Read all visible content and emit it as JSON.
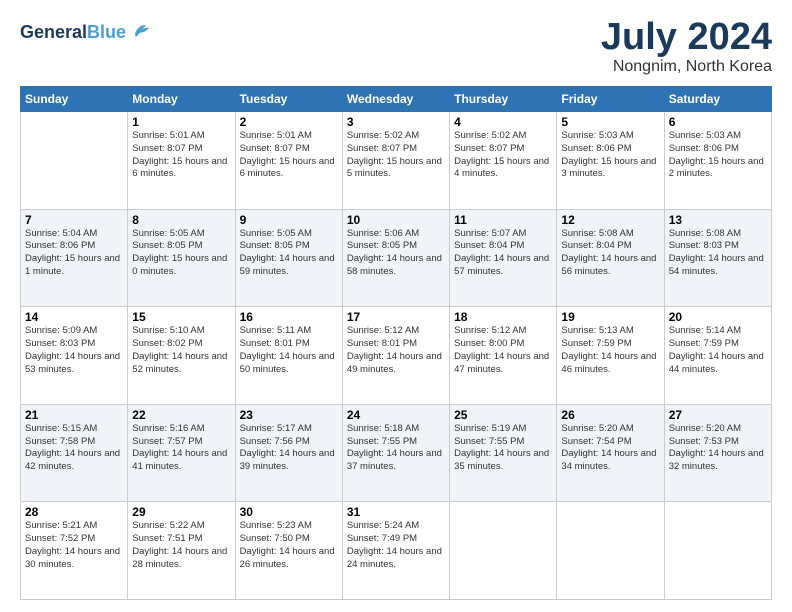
{
  "header": {
    "logo_general": "General",
    "logo_blue": "Blue",
    "month": "July 2024",
    "location": "Nongnim, North Korea"
  },
  "weekdays": [
    "Sunday",
    "Monday",
    "Tuesday",
    "Wednesday",
    "Thursday",
    "Friday",
    "Saturday"
  ],
  "weeks": [
    [
      {
        "day": "",
        "sunrise": "",
        "sunset": "",
        "daylight": ""
      },
      {
        "day": "1",
        "sunrise": "Sunrise: 5:01 AM",
        "sunset": "Sunset: 8:07 PM",
        "daylight": "Daylight: 15 hours and 6 minutes."
      },
      {
        "day": "2",
        "sunrise": "Sunrise: 5:01 AM",
        "sunset": "Sunset: 8:07 PM",
        "daylight": "Daylight: 15 hours and 6 minutes."
      },
      {
        "day": "3",
        "sunrise": "Sunrise: 5:02 AM",
        "sunset": "Sunset: 8:07 PM",
        "daylight": "Daylight: 15 hours and 5 minutes."
      },
      {
        "day": "4",
        "sunrise": "Sunrise: 5:02 AM",
        "sunset": "Sunset: 8:07 PM",
        "daylight": "Daylight: 15 hours and 4 minutes."
      },
      {
        "day": "5",
        "sunrise": "Sunrise: 5:03 AM",
        "sunset": "Sunset: 8:06 PM",
        "daylight": "Daylight: 15 hours and 3 minutes."
      },
      {
        "day": "6",
        "sunrise": "Sunrise: 5:03 AM",
        "sunset": "Sunset: 8:06 PM",
        "daylight": "Daylight: 15 hours and 2 minutes."
      }
    ],
    [
      {
        "day": "7",
        "sunrise": "Sunrise: 5:04 AM",
        "sunset": "Sunset: 8:06 PM",
        "daylight": "Daylight: 15 hours and 1 minute."
      },
      {
        "day": "8",
        "sunrise": "Sunrise: 5:05 AM",
        "sunset": "Sunset: 8:05 PM",
        "daylight": "Daylight: 15 hours and 0 minutes."
      },
      {
        "day": "9",
        "sunrise": "Sunrise: 5:05 AM",
        "sunset": "Sunset: 8:05 PM",
        "daylight": "Daylight: 14 hours and 59 minutes."
      },
      {
        "day": "10",
        "sunrise": "Sunrise: 5:06 AM",
        "sunset": "Sunset: 8:05 PM",
        "daylight": "Daylight: 14 hours and 58 minutes."
      },
      {
        "day": "11",
        "sunrise": "Sunrise: 5:07 AM",
        "sunset": "Sunset: 8:04 PM",
        "daylight": "Daylight: 14 hours and 57 minutes."
      },
      {
        "day": "12",
        "sunrise": "Sunrise: 5:08 AM",
        "sunset": "Sunset: 8:04 PM",
        "daylight": "Daylight: 14 hours and 56 minutes."
      },
      {
        "day": "13",
        "sunrise": "Sunrise: 5:08 AM",
        "sunset": "Sunset: 8:03 PM",
        "daylight": "Daylight: 14 hours and 54 minutes."
      }
    ],
    [
      {
        "day": "14",
        "sunrise": "Sunrise: 5:09 AM",
        "sunset": "Sunset: 8:03 PM",
        "daylight": "Daylight: 14 hours and 53 minutes."
      },
      {
        "day": "15",
        "sunrise": "Sunrise: 5:10 AM",
        "sunset": "Sunset: 8:02 PM",
        "daylight": "Daylight: 14 hours and 52 minutes."
      },
      {
        "day": "16",
        "sunrise": "Sunrise: 5:11 AM",
        "sunset": "Sunset: 8:01 PM",
        "daylight": "Daylight: 14 hours and 50 minutes."
      },
      {
        "day": "17",
        "sunrise": "Sunrise: 5:12 AM",
        "sunset": "Sunset: 8:01 PM",
        "daylight": "Daylight: 14 hours and 49 minutes."
      },
      {
        "day": "18",
        "sunrise": "Sunrise: 5:12 AM",
        "sunset": "Sunset: 8:00 PM",
        "daylight": "Daylight: 14 hours and 47 minutes."
      },
      {
        "day": "19",
        "sunrise": "Sunrise: 5:13 AM",
        "sunset": "Sunset: 7:59 PM",
        "daylight": "Daylight: 14 hours and 46 minutes."
      },
      {
        "day": "20",
        "sunrise": "Sunrise: 5:14 AM",
        "sunset": "Sunset: 7:59 PM",
        "daylight": "Daylight: 14 hours and 44 minutes."
      }
    ],
    [
      {
        "day": "21",
        "sunrise": "Sunrise: 5:15 AM",
        "sunset": "Sunset: 7:58 PM",
        "daylight": "Daylight: 14 hours and 42 minutes."
      },
      {
        "day": "22",
        "sunrise": "Sunrise: 5:16 AM",
        "sunset": "Sunset: 7:57 PM",
        "daylight": "Daylight: 14 hours and 41 minutes."
      },
      {
        "day": "23",
        "sunrise": "Sunrise: 5:17 AM",
        "sunset": "Sunset: 7:56 PM",
        "daylight": "Daylight: 14 hours and 39 minutes."
      },
      {
        "day": "24",
        "sunrise": "Sunrise: 5:18 AM",
        "sunset": "Sunset: 7:55 PM",
        "daylight": "Daylight: 14 hours and 37 minutes."
      },
      {
        "day": "25",
        "sunrise": "Sunrise: 5:19 AM",
        "sunset": "Sunset: 7:55 PM",
        "daylight": "Daylight: 14 hours and 35 minutes."
      },
      {
        "day": "26",
        "sunrise": "Sunrise: 5:20 AM",
        "sunset": "Sunset: 7:54 PM",
        "daylight": "Daylight: 14 hours and 34 minutes."
      },
      {
        "day": "27",
        "sunrise": "Sunrise: 5:20 AM",
        "sunset": "Sunset: 7:53 PM",
        "daylight": "Daylight: 14 hours and 32 minutes."
      }
    ],
    [
      {
        "day": "28",
        "sunrise": "Sunrise: 5:21 AM",
        "sunset": "Sunset: 7:52 PM",
        "daylight": "Daylight: 14 hours and 30 minutes."
      },
      {
        "day": "29",
        "sunrise": "Sunrise: 5:22 AM",
        "sunset": "Sunset: 7:51 PM",
        "daylight": "Daylight: 14 hours and 28 minutes."
      },
      {
        "day": "30",
        "sunrise": "Sunrise: 5:23 AM",
        "sunset": "Sunset: 7:50 PM",
        "daylight": "Daylight: 14 hours and 26 minutes."
      },
      {
        "day": "31",
        "sunrise": "Sunrise: 5:24 AM",
        "sunset": "Sunset: 7:49 PM",
        "daylight": "Daylight: 14 hours and 24 minutes."
      },
      {
        "day": "",
        "sunrise": "",
        "sunset": "",
        "daylight": ""
      },
      {
        "day": "",
        "sunrise": "",
        "sunset": "",
        "daylight": ""
      },
      {
        "day": "",
        "sunrise": "",
        "sunset": "",
        "daylight": ""
      }
    ]
  ]
}
